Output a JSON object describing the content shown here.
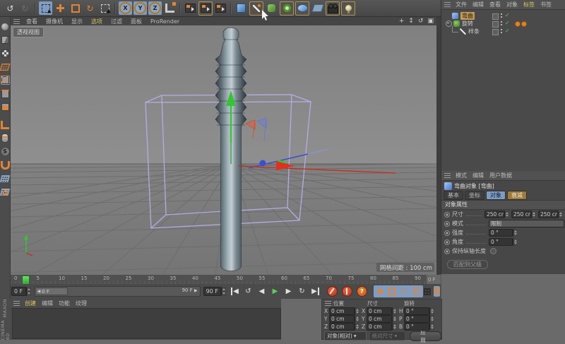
{
  "app": {
    "brand_top": "MAXON",
    "brand_bottom": "CINEMA 4D"
  },
  "icons": {
    "undo": "↺",
    "redo": "↻",
    "rotate": "↻",
    "check": "✓",
    "tri_left": "◀",
    "tri_right": "▶",
    "tri_down": "▾",
    "loop": "↻",
    "play_back": "↺",
    "pan": "+",
    "zoom": "↕",
    "orbit": "↺",
    "maximize": "▣",
    "letter_p": "P",
    "question": "?"
  },
  "top_toolbar": {
    "axis_locks": [
      "X",
      "Y",
      "Z"
    ]
  },
  "viewport": {
    "menu": {
      "items": [
        {
          "label": "查看",
          "active": false
        },
        {
          "label": "摄像机",
          "active": false
        },
        {
          "label": "显示",
          "active": false
        },
        {
          "label": "选项",
          "active": true
        },
        {
          "label": "过滤",
          "active": false
        },
        {
          "label": "面板",
          "active": false
        },
        {
          "label": "ProRender",
          "active": false
        }
      ]
    },
    "view_label": "透视视图",
    "grid_label": "网格间距 : 100 cm"
  },
  "object_manager": {
    "menu": [
      {
        "label": "文件",
        "active": false
      },
      {
        "label": "编辑",
        "active": false
      },
      {
        "label": "查看",
        "active": false
      },
      {
        "label": "对象",
        "active": false
      },
      {
        "label": "标签",
        "active": true
      },
      {
        "label": "书签",
        "active": false
      }
    ],
    "objects": [
      {
        "name": "弯曲",
        "type": "bend",
        "selected": true
      },
      {
        "name": "旋转",
        "type": "lathe",
        "selected": false
      },
      {
        "name": "样条",
        "type": "spline",
        "selected": false
      }
    ]
  },
  "attribute_manager": {
    "menu": [
      {
        "label": "模式"
      },
      {
        "label": "编辑"
      },
      {
        "label": "用户数据"
      }
    ],
    "title": "弯曲对象 [弯曲]",
    "tabs": [
      {
        "label": "基本"
      },
      {
        "label": "坐标"
      },
      {
        "label": "对象",
        "active": true
      },
      {
        "label": "衰减",
        "accent": true
      }
    ],
    "section": "对象属性",
    "props": {
      "size": {
        "label": "尺寸",
        "values": [
          "250 cm",
          "250 cm",
          "250 cm"
        ]
      },
      "mode": {
        "label": "模式",
        "value": "限制"
      },
      "strength": {
        "label": "强度",
        "value": "0 °"
      },
      "angle": {
        "label": "角度",
        "value": "0 °"
      },
      "keep_length": {
        "label": "保持纵轴长度",
        "checked": false
      },
      "fit_parent_label": "匹配到父级"
    }
  },
  "timeline": {
    "ticks": [
      "0",
      "5",
      "10",
      "15",
      "20",
      "25",
      "30",
      "35",
      "40",
      "45",
      "50",
      "55",
      "60",
      "65",
      "70",
      "75",
      "80",
      "85",
      "90"
    ],
    "right_field": "0 F",
    "current_field": "0 F",
    "thumb_label": "0 F",
    "end_marker": "90 F",
    "end_field": "90 F"
  },
  "materials": {
    "menu": [
      {
        "label": "创建",
        "active": true
      },
      {
        "label": "编辑",
        "active": false
      },
      {
        "label": "功能",
        "active": false
      },
      {
        "label": "纹理",
        "active": false
      }
    ]
  },
  "coordinates": {
    "headers": [
      "位置",
      "尺寸",
      "旋转"
    ],
    "rows": [
      {
        "pl": "X",
        "pv": "0 cm",
        "sl": "X",
        "sv": "0 cm",
        "rl": "H",
        "rv": "0 °"
      },
      {
        "pl": "Y",
        "pv": "0 cm",
        "sl": "Y",
        "sv": "0 cm",
        "rl": "P",
        "rv": "0 °"
      },
      {
        "pl": "Z",
        "pv": "0 cm",
        "sl": "Z",
        "sv": "0 cm",
        "rl": "B",
        "rv": "0 °"
      }
    ],
    "mode_dropdown": "对象(相对)",
    "size_dropdown": "绝对尺寸",
    "apply": "应用"
  },
  "colors": {
    "accent_yellow": "#d8c468",
    "selection_tan": "#c59a55",
    "gizmo_red": "#e03020",
    "gizmo_green": "#35c435",
    "gizmo_blue": "#3a4fd0",
    "cage_purple": "#b7aee9",
    "keying_blue": "#7e9cc4"
  }
}
